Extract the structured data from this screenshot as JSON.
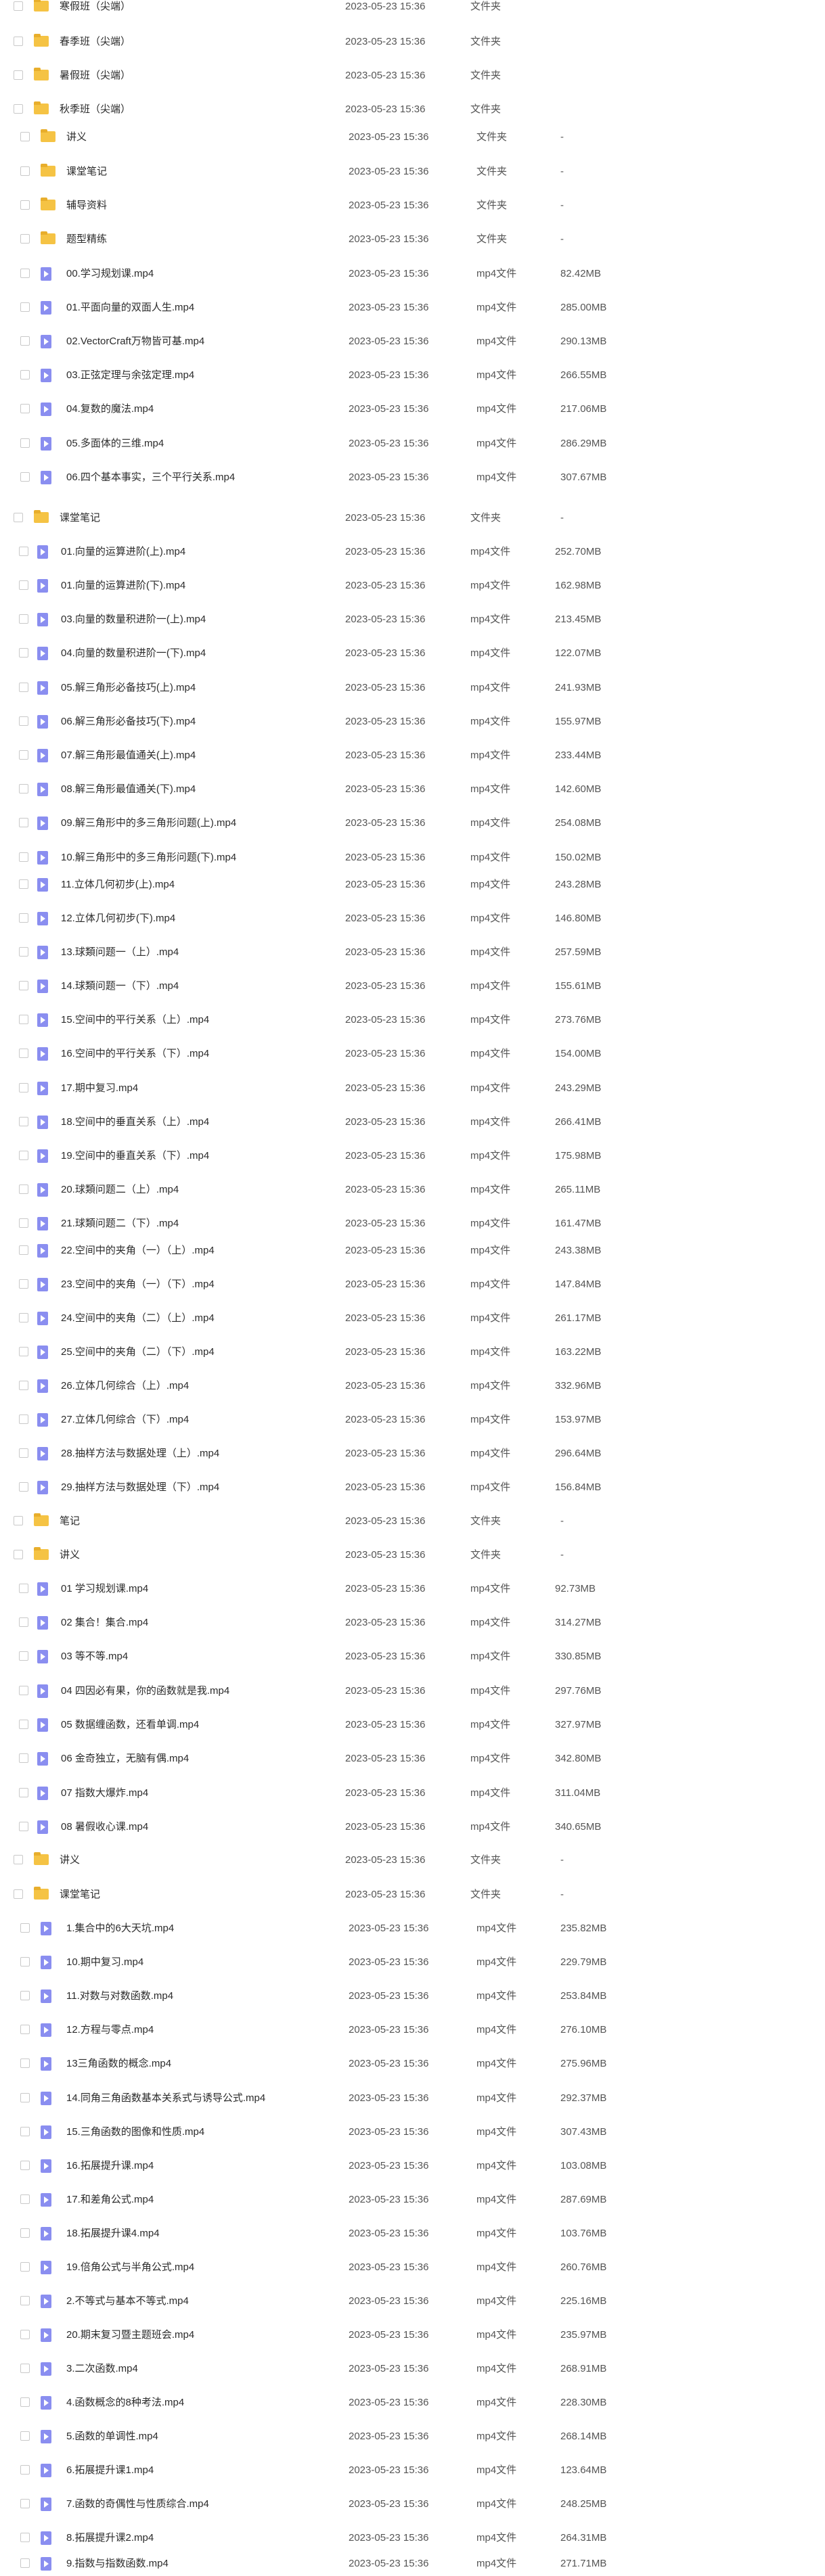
{
  "items": [
    {
      "name": "寒假班（尖端）",
      "date": "2023-05-23 15:36",
      "type": "文件夹",
      "size": "",
      "kind": "folder"
    },
    {
      "name": "春季班（尖端）",
      "date": "2023-05-23 15:36",
      "type": "文件夹",
      "size": "",
      "kind": "folder"
    },
    {
      "name": "暑假班（尖端）",
      "date": "2023-05-23 15:36",
      "type": "文件夹",
      "size": "",
      "kind": "folder"
    },
    {
      "name": "秋季班（尖端）",
      "date": "2023-05-23 15:36",
      "type": "文件夹",
      "size": "",
      "kind": "folder"
    },
    {
      "name": "讲义",
      "date": "2023-05-23 15:36",
      "type": "文件夹",
      "size": "-",
      "kind": "folder"
    },
    {
      "name": "课堂笔记",
      "date": "2023-05-23 15:36",
      "type": "文件夹",
      "size": "-",
      "kind": "folder"
    },
    {
      "name": "辅导资料",
      "date": "2023-05-23 15:36",
      "type": "文件夹",
      "size": "-",
      "kind": "folder"
    },
    {
      "name": "题型精练",
      "date": "2023-05-23 15:36",
      "type": "文件夹",
      "size": "-",
      "kind": "folder"
    },
    {
      "name": "00.学习规划课.mp4",
      "date": "2023-05-23 15:36",
      "type": "mp4文件",
      "size": "82.42MB",
      "kind": "video"
    },
    {
      "name": "01.平面向量的双面人生.mp4",
      "date": "2023-05-23 15:36",
      "type": "mp4文件",
      "size": "285.00MB",
      "kind": "video"
    },
    {
      "name": "02.VectorCraft万物皆可基.mp4",
      "date": "2023-05-23 15:36",
      "type": "mp4文件",
      "size": "290.13MB",
      "kind": "video"
    },
    {
      "name": "03.正弦定理与余弦定理.mp4",
      "date": "2023-05-23 15:36",
      "type": "mp4文件",
      "size": "266.55MB",
      "kind": "video"
    },
    {
      "name": "04.复数的魔法.mp4",
      "date": "2023-05-23 15:36",
      "type": "mp4文件",
      "size": "217.06MB",
      "kind": "video"
    },
    {
      "name": "05.多面体的三维.mp4",
      "date": "2023-05-23 15:36",
      "type": "mp4文件",
      "size": "286.29MB",
      "kind": "video"
    },
    {
      "name": "06.四个基本事实，三个平行关系.mp4",
      "date": "2023-05-23 15:36",
      "type": "mp4文件",
      "size": "307.67MB",
      "kind": "video"
    },
    {
      "name": "课堂笔记",
      "date": "2023-05-23 15:36",
      "type": "文件夹",
      "size": "-",
      "kind": "folder"
    },
    {
      "name": "01.向量的运算进阶(上).mp4",
      "date": "2023-05-23 15:36",
      "type": "mp4文件",
      "size": "252.70MB",
      "kind": "video"
    },
    {
      "name": "01.向量的运算进阶(下).mp4",
      "date": "2023-05-23 15:36",
      "type": "mp4文件",
      "size": "162.98MB",
      "kind": "video"
    },
    {
      "name": "03.向量的数量积进阶一(上).mp4",
      "date": "2023-05-23 15:36",
      "type": "mp4文件",
      "size": "213.45MB",
      "kind": "video"
    },
    {
      "name": "04.向量的数量积进阶一(下).mp4",
      "date": "2023-05-23 15:36",
      "type": "mp4文件",
      "size": "122.07MB",
      "kind": "video"
    },
    {
      "name": "05.解三角形必备技巧(上).mp4",
      "date": "2023-05-23 15:36",
      "type": "mp4文件",
      "size": "241.93MB",
      "kind": "video"
    },
    {
      "name": "06.解三角形必备技巧(下).mp4",
      "date": "2023-05-23 15:36",
      "type": "mp4文件",
      "size": "155.97MB",
      "kind": "video"
    },
    {
      "name": "07.解三角形最值通关(上).mp4",
      "date": "2023-05-23 15:36",
      "type": "mp4文件",
      "size": "233.44MB",
      "kind": "video"
    },
    {
      "name": "08.解三角形最值通关(下).mp4",
      "date": "2023-05-23 15:36",
      "type": "mp4文件",
      "size": "142.60MB",
      "kind": "video"
    },
    {
      "name": "09.解三角形中的多三角形问题(上).mp4",
      "date": "2023-05-23 15:36",
      "type": "mp4文件",
      "size": "254.08MB",
      "kind": "video"
    },
    {
      "name": "10.解三角形中的多三角形问题(下).mp4",
      "date": "2023-05-23 15:36",
      "type": "mp4文件",
      "size": "150.02MB",
      "kind": "video"
    },
    {
      "name": "11.立体几何初步(上).mp4",
      "date": "2023-05-23 15:36",
      "type": "mp4文件",
      "size": "243.28MB",
      "kind": "video"
    },
    {
      "name": "12.立体几何初步(下).mp4",
      "date": "2023-05-23 15:36",
      "type": "mp4文件",
      "size": "146.80MB",
      "kind": "video"
    },
    {
      "name": "13.球類问题一（上）.mp4",
      "date": "2023-05-23 15:36",
      "type": "mp4文件",
      "size": "257.59MB",
      "kind": "video"
    },
    {
      "name": "14.球類问题一（下）.mp4",
      "date": "2023-05-23 15:36",
      "type": "mp4文件",
      "size": "155.61MB",
      "kind": "video"
    },
    {
      "name": "15.空间中的平行关系（上）.mp4",
      "date": "2023-05-23 15:36",
      "type": "mp4文件",
      "size": "273.76MB",
      "kind": "video"
    },
    {
      "name": "16.空间中的平行关系（下）.mp4",
      "date": "2023-05-23 15:36",
      "type": "mp4文件",
      "size": "154.00MB",
      "kind": "video"
    },
    {
      "name": "17.期中复习.mp4",
      "date": "2023-05-23 15:36",
      "type": "mp4文件",
      "size": "243.29MB",
      "kind": "video"
    },
    {
      "name": "18.空间中的垂直关系（上）.mp4",
      "date": "2023-05-23 15:36",
      "type": "mp4文件",
      "size": "266.41MB",
      "kind": "video"
    },
    {
      "name": "19.空间中的垂直关系（下）.mp4",
      "date": "2023-05-23 15:36",
      "type": "mp4文件",
      "size": "175.98MB",
      "kind": "video"
    },
    {
      "name": "20.球類问题二（上）.mp4",
      "date": "2023-05-23 15:36",
      "type": "mp4文件",
      "size": "265.11MB",
      "kind": "video"
    },
    {
      "name": "21.球類问题二（下）.mp4",
      "date": "2023-05-23 15:36",
      "type": "mp4文件",
      "size": "161.47MB",
      "kind": "video"
    },
    {
      "name": "22.空间中的夹角（一）（上）.mp4",
      "date": "2023-05-23 15:36",
      "type": "mp4文件",
      "size": "243.38MB",
      "kind": "video"
    },
    {
      "name": "23.空间中的夹角（一）（下）.mp4",
      "date": "2023-05-23 15:36",
      "type": "mp4文件",
      "size": "147.84MB",
      "kind": "video"
    },
    {
      "name": "24.空间中的夹角（二）（上）.mp4",
      "date": "2023-05-23 15:36",
      "type": "mp4文件",
      "size": "261.17MB",
      "kind": "video"
    },
    {
      "name": "25.空间中的夹角（二）（下）.mp4",
      "date": "2023-05-23 15:36",
      "type": "mp4文件",
      "size": "163.22MB",
      "kind": "video"
    },
    {
      "name": "26.立体几何综合（上）.mp4",
      "date": "2023-05-23 15:36",
      "type": "mp4文件",
      "size": "332.96MB",
      "kind": "video"
    },
    {
      "name": "27.立体几何综合（下）.mp4",
      "date": "2023-05-23 15:36",
      "type": "mp4文件",
      "size": "153.97MB",
      "kind": "video"
    },
    {
      "name": "28.抽样方法与数据处理（上）.mp4",
      "date": "2023-05-23 15:36",
      "type": "mp4文件",
      "size": "296.64MB",
      "kind": "video"
    },
    {
      "name": "29.抽样方法与数据处理（下）.mp4",
      "date": "2023-05-23 15:36",
      "type": "mp4文件",
      "size": "156.84MB",
      "kind": "video"
    },
    {
      "name": "笔记",
      "date": "2023-05-23 15:36",
      "type": "文件夹",
      "size": "-",
      "kind": "folder"
    },
    {
      "name": "讲义",
      "date": "2023-05-23 15:36",
      "type": "文件夹",
      "size": "-",
      "kind": "folder"
    },
    {
      "name": "01 学习规划课.mp4",
      "date": "2023-05-23 15:36",
      "type": "mp4文件",
      "size": "92.73MB",
      "kind": "video"
    },
    {
      "name": "02 集合！集合.mp4",
      "date": "2023-05-23 15:36",
      "type": "mp4文件",
      "size": "314.27MB",
      "kind": "video"
    },
    {
      "name": "03 等不等.mp4",
      "date": "2023-05-23 15:36",
      "type": "mp4文件",
      "size": "330.85MB",
      "kind": "video"
    },
    {
      "name": "04 四因必有果，你的函数就是我.mp4",
      "date": "2023-05-23 15:36",
      "type": "mp4文件",
      "size": "297.76MB",
      "kind": "video"
    },
    {
      "name": "05 数据缠函数，还看单调.mp4",
      "date": "2023-05-23 15:36",
      "type": "mp4文件",
      "size": "327.97MB",
      "kind": "video"
    },
    {
      "name": "06 金奇独立，无脑有偶.mp4",
      "date": "2023-05-23 15:36",
      "type": "mp4文件",
      "size": "342.80MB",
      "kind": "video"
    },
    {
      "name": "07 指数大爆炸.mp4",
      "date": "2023-05-23 15:36",
      "type": "mp4文件",
      "size": "311.04MB",
      "kind": "video"
    },
    {
      "name": "08 暑假收心课.mp4",
      "date": "2023-05-23 15:36",
      "type": "mp4文件",
      "size": "340.65MB",
      "kind": "video"
    },
    {
      "name": "讲义",
      "date": "2023-05-23 15:36",
      "type": "文件夹",
      "size": "-",
      "kind": "folder"
    },
    {
      "name": "课堂笔记",
      "date": "2023-05-23 15:36",
      "type": "文件夹",
      "size": "-",
      "kind": "folder"
    },
    {
      "name": "1.集合中的6大天坑.mp4",
      "date": "2023-05-23 15:36",
      "type": "mp4文件",
      "size": "235.82MB",
      "kind": "video"
    },
    {
      "name": "10.期中复习.mp4",
      "date": "2023-05-23 15:36",
      "type": "mp4文件",
      "size": "229.79MB",
      "kind": "video"
    },
    {
      "name": "11.对数与对数函数.mp4",
      "date": "2023-05-23 15:36",
      "type": "mp4文件",
      "size": "253.84MB",
      "kind": "video"
    },
    {
      "name": "12.方程与零点.mp4",
      "date": "2023-05-23 15:36",
      "type": "mp4文件",
      "size": "276.10MB",
      "kind": "video"
    },
    {
      "name": "13三角函数的概念.mp4",
      "date": "2023-05-23 15:36",
      "type": "mp4文件",
      "size": "275.96MB",
      "kind": "video"
    },
    {
      "name": "14.同角三角函数基本关系式与诱导公式.mp4",
      "date": "2023-05-23 15:36",
      "type": "mp4文件",
      "size": "292.37MB",
      "kind": "video"
    },
    {
      "name": "15.三角函数的图像和性质.mp4",
      "date": "2023-05-23 15:36",
      "type": "mp4文件",
      "size": "307.43MB",
      "kind": "video"
    },
    {
      "name": "16.拓展提升课.mp4",
      "date": "2023-05-23 15:36",
      "type": "mp4文件",
      "size": "103.08MB",
      "kind": "video"
    },
    {
      "name": "17.和差角公式.mp4",
      "date": "2023-05-23 15:36",
      "type": "mp4文件",
      "size": "287.69MB",
      "kind": "video"
    },
    {
      "name": "18.拓展提升课4.mp4",
      "date": "2023-05-23 15:36",
      "type": "mp4文件",
      "size": "103.76MB",
      "kind": "video"
    },
    {
      "name": "19.倍角公式与半角公式.mp4",
      "date": "2023-05-23 15:36",
      "type": "mp4文件",
      "size": "260.76MB",
      "kind": "video"
    },
    {
      "name": "2.不等式与基本不等式.mp4",
      "date": "2023-05-23 15:36",
      "type": "mp4文件",
      "size": "225.16MB",
      "kind": "video"
    },
    {
      "name": "20.期末复习暨主题班会.mp4",
      "date": "2023-05-23 15:36",
      "type": "mp4文件",
      "size": "235.97MB",
      "kind": "video"
    },
    {
      "name": "3.二次函数.mp4",
      "date": "2023-05-23 15:36",
      "type": "mp4文件",
      "size": "268.91MB",
      "kind": "video"
    },
    {
      "name": "4.函数概念的8种考法.mp4",
      "date": "2023-05-23 15:36",
      "type": "mp4文件",
      "size": "228.30MB",
      "kind": "video"
    },
    {
      "name": "5.函数的单调性.mp4",
      "date": "2023-05-23 15:36",
      "type": "mp4文件",
      "size": "268.14MB",
      "kind": "video"
    },
    {
      "name": "6.拓展提升课1.mp4",
      "date": "2023-05-23 15:36",
      "type": "mp4文件",
      "size": "123.64MB",
      "kind": "video"
    },
    {
      "name": "7.函数的奇偶性与性质综合.mp4",
      "date": "2023-05-23 15:36",
      "type": "mp4文件",
      "size": "248.25MB",
      "kind": "video"
    },
    {
      "name": "8.拓展提升课2.mp4",
      "date": "2023-05-23 15:36",
      "type": "mp4文件",
      "size": "264.31MB",
      "kind": "video"
    },
    {
      "name": "9.指数与指数函数.mp4",
      "date": "2023-05-23 15:36",
      "type": "mp4文件",
      "size": "271.71MB",
      "kind": "video"
    }
  ]
}
